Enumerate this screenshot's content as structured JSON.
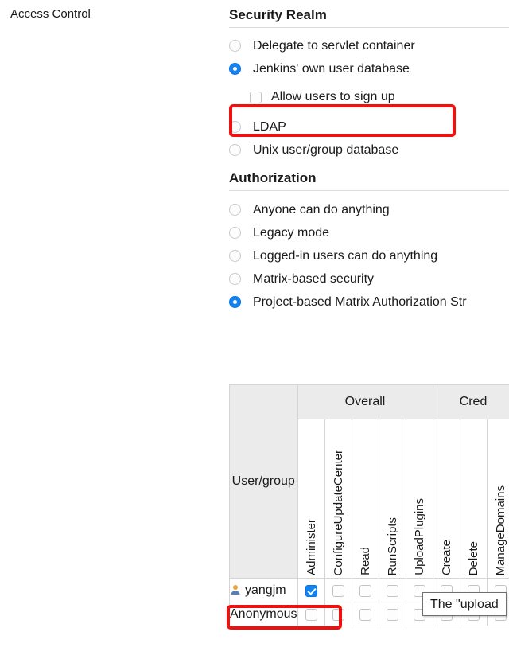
{
  "page": {
    "left_label": "Access Control"
  },
  "security_realm": {
    "title": "Security Realm",
    "options": [
      {
        "label": "Delegate to servlet container",
        "selected": false
      },
      {
        "label": "Jenkins' own user database",
        "selected": true
      },
      {
        "label": "LDAP",
        "selected": false
      },
      {
        "label": "Unix user/group database",
        "selected": false
      }
    ],
    "signup": {
      "label": "Allow users to sign up",
      "checked": false,
      "highlighted": true
    }
  },
  "authorization": {
    "title": "Authorization",
    "options": [
      {
        "label": "Anyone can do anything",
        "selected": false
      },
      {
        "label": "Legacy mode",
        "selected": false
      },
      {
        "label": "Logged-in users can do anything",
        "selected": false
      },
      {
        "label": "Matrix-based security",
        "selected": false
      },
      {
        "label": "Project-based Matrix Authorization Str",
        "selected": true
      }
    ]
  },
  "matrix": {
    "usergroup_header": "User/group",
    "groups": [
      {
        "label": "Overall",
        "span": 5
      },
      {
        "label": "Cred",
        "span": 3
      }
    ],
    "columns": [
      "Administer",
      "ConfigureUpdateCenter",
      "Read",
      "RunScripts",
      "UploadPlugins",
      "Create",
      "Delete",
      "ManageDomains"
    ],
    "rows": [
      {
        "name": "yangjm",
        "has_user_icon": true,
        "highlighted": false,
        "checks": [
          true,
          false,
          false,
          false,
          false,
          false,
          false,
          false
        ]
      },
      {
        "name": "Anonymous",
        "has_user_icon": false,
        "highlighted": true,
        "checks": [
          false,
          false,
          false,
          false,
          false,
          false,
          false,
          false
        ]
      }
    ]
  },
  "tooltip": {
    "text": "The \"upload"
  },
  "colors": {
    "accent": "#1283f0",
    "highlight": "#f40f0f",
    "header_bg": "#ebebeb",
    "border": "#d5d5d5"
  }
}
